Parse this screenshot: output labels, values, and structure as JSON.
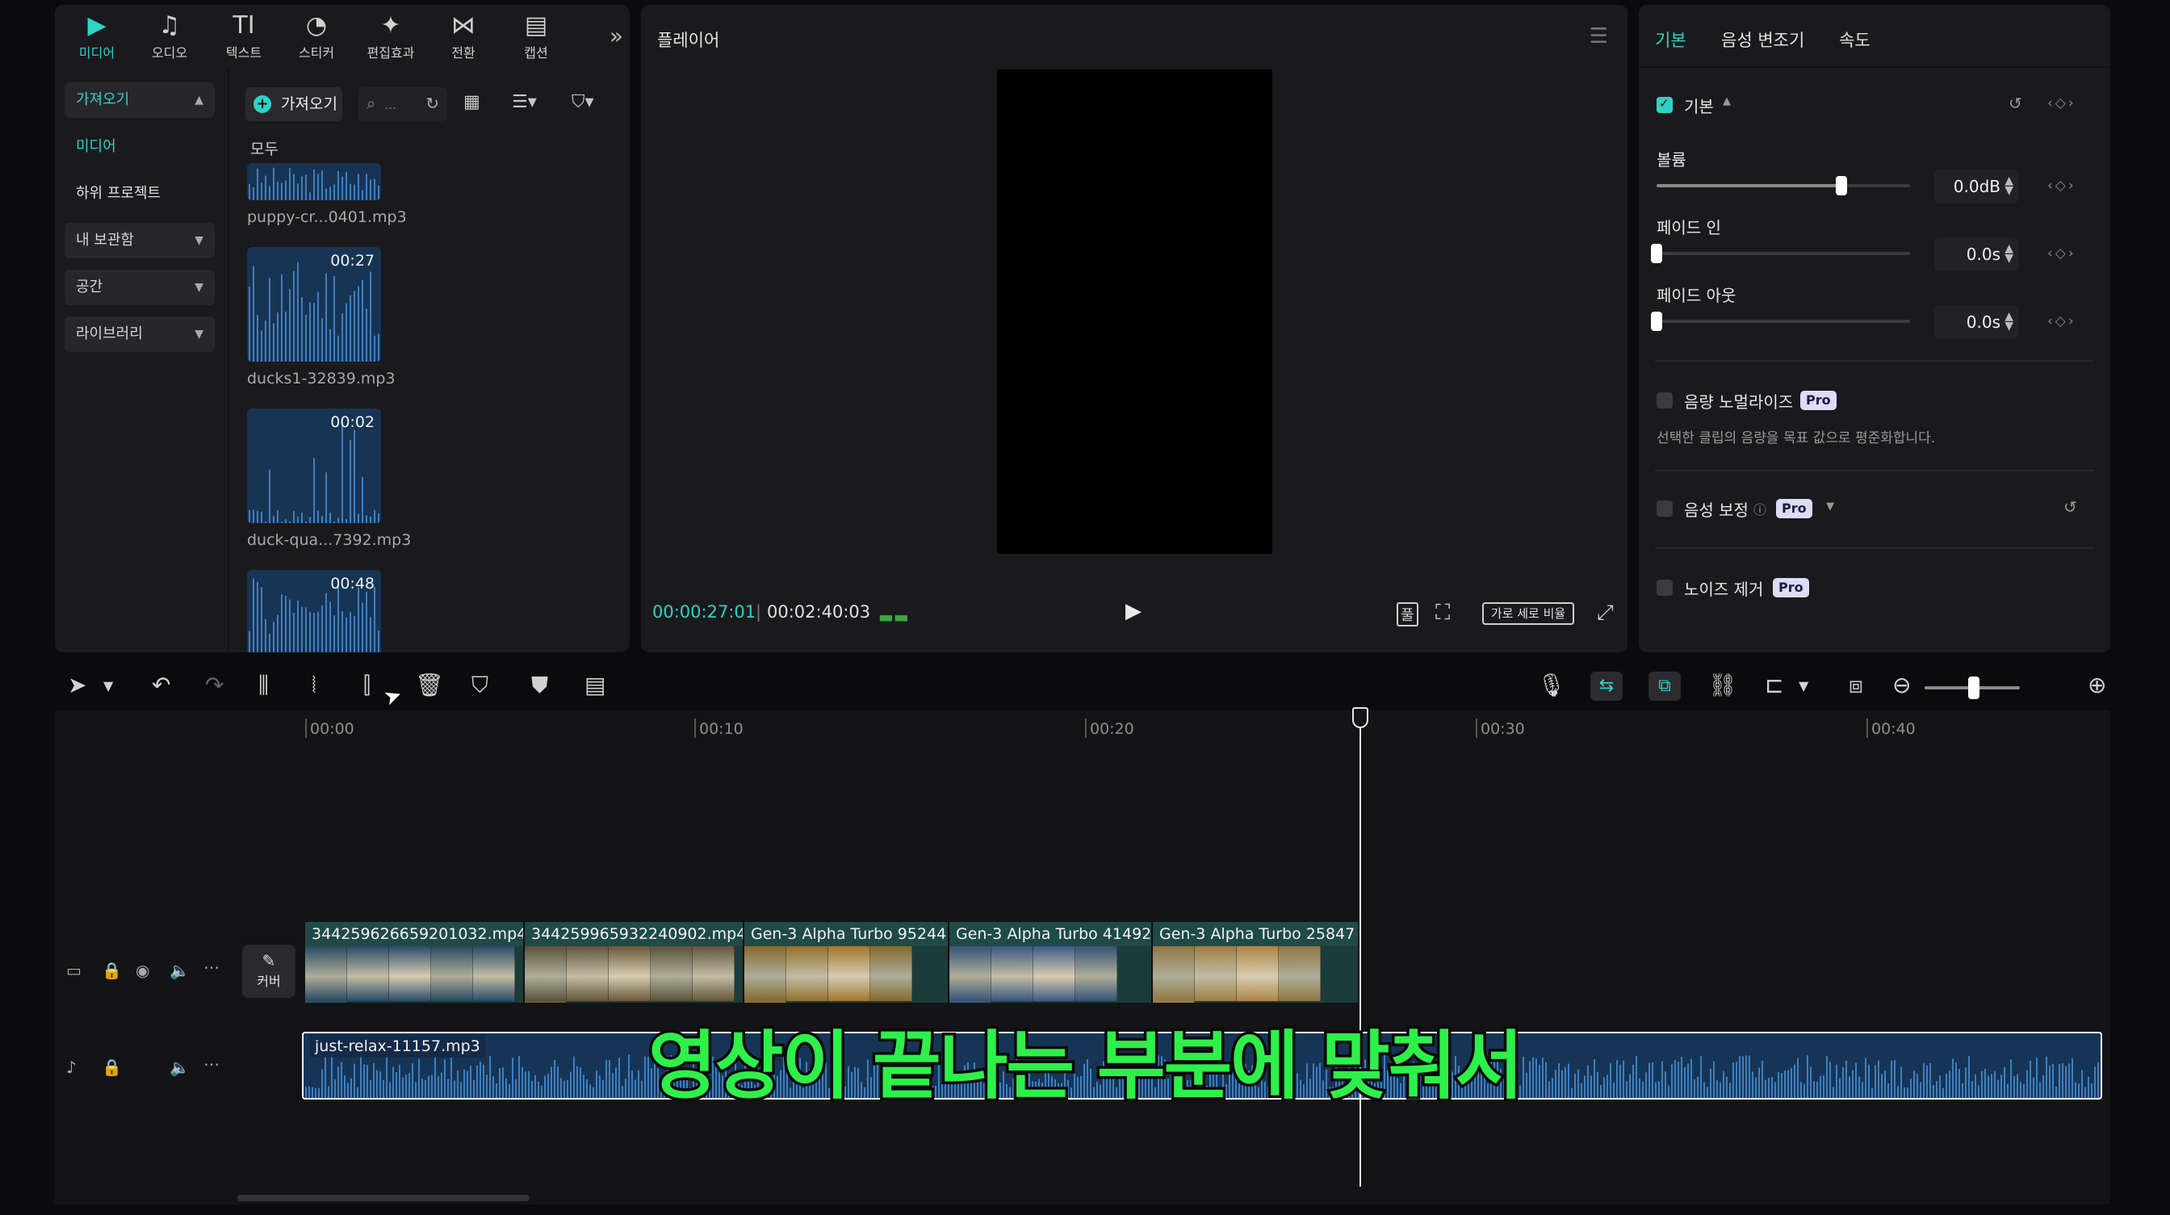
{
  "media_tabs": [
    {
      "label": "미디어",
      "icon": "media-icon",
      "glyph": "▶",
      "active": true
    },
    {
      "label": "오디오",
      "icon": "audio-icon",
      "glyph": "♫",
      "active": false
    },
    {
      "label": "텍스트",
      "icon": "text-icon",
      "glyph": "TI",
      "active": false
    },
    {
      "label": "스티커",
      "icon": "sticker-icon",
      "glyph": "◔",
      "active": false
    },
    {
      "label": "편집효과",
      "icon": "effects-icon",
      "glyph": "✦",
      "active": false
    },
    {
      "label": "전환",
      "icon": "transition-icon",
      "glyph": "⋈",
      "active": false
    },
    {
      "label": "캡션",
      "icon": "caption-icon",
      "glyph": "▤",
      "active": false
    }
  ],
  "sidebar": {
    "import_group": "가져오기",
    "media": "미디어",
    "sub_project": "하위 프로젝트",
    "my_library": "내 보관함",
    "space": "공간",
    "library": "라이브러리"
  },
  "media_toolbar": {
    "import_label": "가져오기",
    "search_placeholder": "..."
  },
  "media_list": {
    "all_label": "모두",
    "items": [
      {
        "name": "puppy-cr...0401.mp3",
        "duration": ""
      },
      {
        "name": "ducks1-32839.mp3",
        "duration": "00:27"
      },
      {
        "name": "duck-qua...7392.mp3",
        "duration": "00:02"
      },
      {
        "name": "",
        "duration": "00:48"
      }
    ]
  },
  "player": {
    "title": "플레이어",
    "current_time": "00:00:27:01",
    "total_time": "00:02:40:03",
    "ratio_label": "가로 세로 비율",
    "fit_label": "풀"
  },
  "inspector": {
    "tabs": [
      "기본",
      "음성 변조기",
      "속도"
    ],
    "section_title": "기본",
    "volume_label": "볼륨",
    "volume_value": "0.0dB",
    "volume_level": 0.73,
    "fade_in_label": "페이드 인",
    "fade_in_value": "0.0s",
    "fade_in_level": 0,
    "fade_out_label": "페이드 아웃",
    "fade_out_value": "0.0s",
    "fade_out_level": 0,
    "normalize_label": "음량 노멀라이즈",
    "normalize_desc": "선택한 클립의 음량을 목표 값으로 평준화합니다.",
    "voice_enhance_label": "음성 보정",
    "noise_label": "노이즈 제거",
    "pro_badge": "Pro"
  },
  "timeline": {
    "ruler": [
      "00:00",
      "00:10",
      "00:20",
      "00:30",
      "00:40"
    ],
    "cover_label": "커버",
    "clips": [
      {
        "name": "344259626659201032.mp4",
        "color": "#2c4e6e"
      },
      {
        "name": "344259965932240902.mp4",
        "color": "#6f5a3b"
      },
      {
        "name": "Gen-3 Alpha Turbo 95244",
        "color": "#a87a2c"
      },
      {
        "name": "Gen-3 Alpha Turbo 41492",
        "color": "#3e5c8a"
      },
      {
        "name": "Gen-3 Alpha Turbo 25847",
        "color": "#b58a45"
      }
    ],
    "audio_clip_name": "just-relax-11157.mp3"
  },
  "subtitle": "영상이 끝나는 부분에 맞춰서",
  "colors": {
    "accent": "#2ed3c6",
    "subtitle": "#2ef04a",
    "audio": "#163556",
    "video": "#1b3c3b"
  }
}
